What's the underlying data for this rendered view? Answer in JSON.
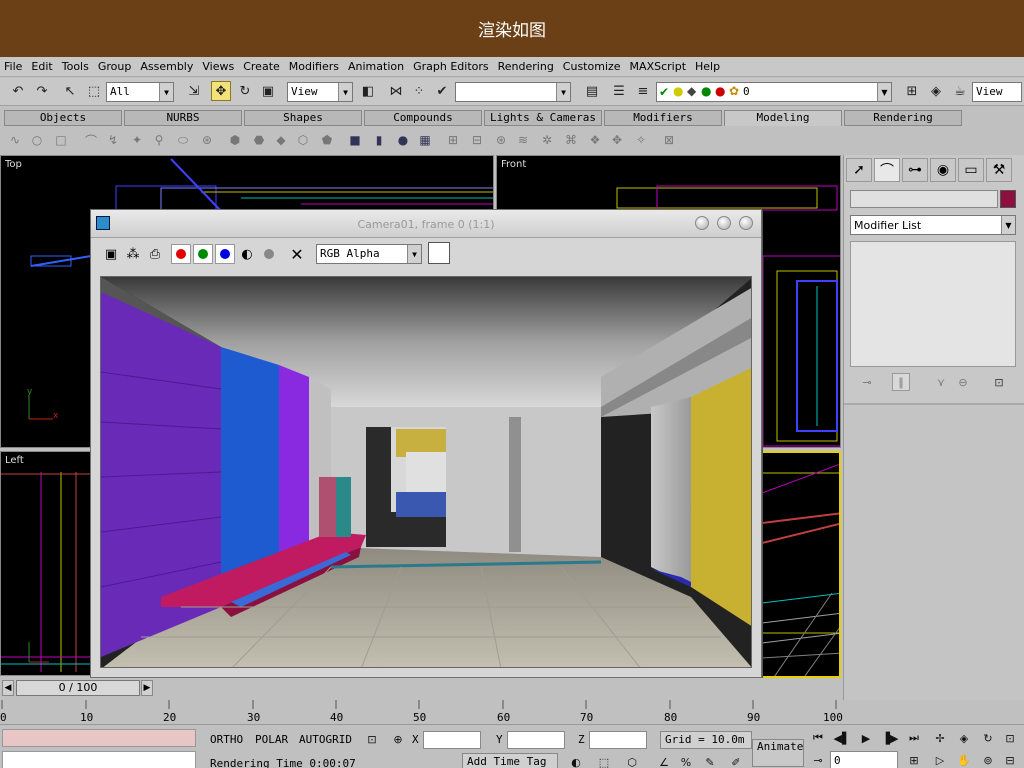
{
  "banner_title": "渲染如图",
  "menu": [
    "File",
    "Edit",
    "Tools",
    "Group",
    "Assembly",
    "Views",
    "Create",
    "Modifiers",
    "Animation",
    "Graph Editors",
    "Rendering",
    "Customize",
    "MAXScript",
    "Help"
  ],
  "toolbar": {
    "selection_filter": "All",
    "ref_coord": "View",
    "named_selection": "",
    "layer_value": "0",
    "right_view": "View"
  },
  "tabs": [
    "Objects",
    "NURBS",
    "Shapes",
    "Compounds",
    "Lights & Cameras",
    "Modifiers",
    "Modeling",
    "Rendering"
  ],
  "active_tab": "Modeling",
  "viewports": {
    "top": "Top",
    "front": "Front",
    "left": "Left"
  },
  "render_window": {
    "title": "Camera01, frame 0 (1:1)",
    "channel": "RGB Alpha"
  },
  "command_panel": {
    "modifier_list": "Modifier List"
  },
  "time_slider": {
    "position": "0 / 100"
  },
  "track_ticks": [
    "0",
    "10",
    "20",
    "30",
    "40",
    "50",
    "60",
    "70",
    "80",
    "90",
    "100"
  ],
  "status": {
    "ortho": "ORTHO",
    "polar": "POLAR",
    "autogrid": "AUTOGRID",
    "x_label": "X",
    "y_label": "Y",
    "z_label": "Z",
    "grid": "Grid = 10.0m",
    "animate": "Animate",
    "rendering_time": "Rendering Time  0:00:07",
    "add_time_tag": "Add Time Tag",
    "frame_value": "0"
  },
  "colors": {
    "banner": "#6b4016",
    "active_button": "#f3e27a",
    "object_color": "#8b1040"
  },
  "icons": [
    "undo-icon",
    "redo-icon",
    "select-icon",
    "select-region-icon",
    "move-icon",
    "rotate-icon",
    "scale-icon",
    "mirror-icon",
    "align-icon",
    "render-icon",
    "save-icon",
    "print-icon",
    "clear-icon"
  ]
}
